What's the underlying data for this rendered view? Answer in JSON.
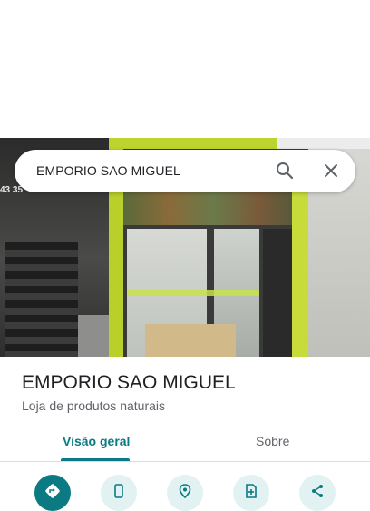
{
  "search": {
    "query": "EMPORIO SAO MIGUEL"
  },
  "photo": {
    "sign_text": "43 35"
  },
  "place": {
    "name": "EMPORIO SAO MIGUEL",
    "category": "Loja de produtos naturais"
  },
  "tabs": [
    {
      "label": "Visão geral",
      "active": true
    },
    {
      "label": "Sobre",
      "active": false
    }
  ],
  "actions": [
    {
      "icon": "directions-icon"
    },
    {
      "icon": "phone-icon"
    },
    {
      "icon": "save-pin-icon"
    },
    {
      "icon": "add-photo-icon"
    },
    {
      "icon": "share-icon"
    }
  ],
  "colors": {
    "accent": "#0b7a82",
    "accent_light": "#e2f1f2",
    "text_primary": "#202124",
    "text_secondary": "#5f6368"
  }
}
